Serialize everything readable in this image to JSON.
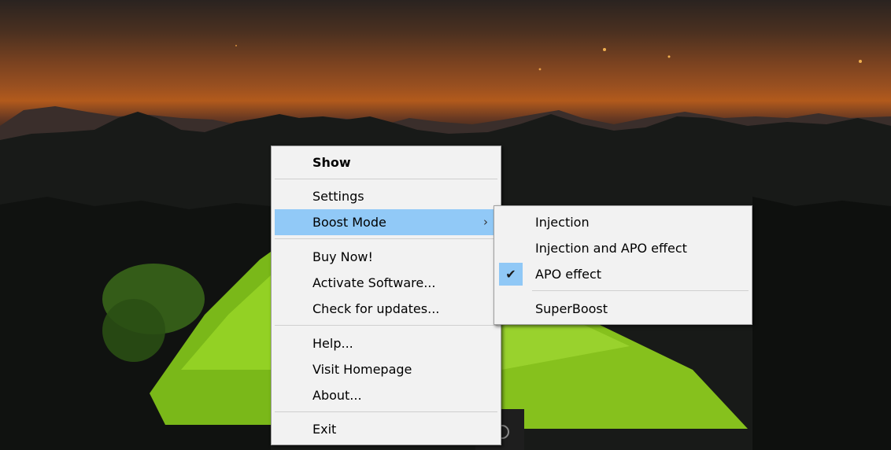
{
  "tray_menu": {
    "show": "Show",
    "settings": "Settings",
    "boost_mode": "Boost Mode",
    "buy_now": "Buy Now!",
    "activate": "Activate Software...",
    "check_updates": "Check for updates...",
    "help": "Help...",
    "visit_homepage": "Visit Homepage",
    "about": "About...",
    "exit": "Exit",
    "submenu_arrow": "›"
  },
  "boost_submenu": {
    "injection": "Injection",
    "injection_apo": "Injection and APO effect",
    "apo_effect": "APO effect",
    "superboost": "SuperBoost",
    "checked_item": "APO effect",
    "check_glyph": "✔"
  },
  "colors": {
    "menu_background": "#f2f2f2",
    "highlight": "#91c9f7",
    "border": "#a0a0a0"
  },
  "icons": {
    "submenu_arrow": "chevron-right-icon",
    "checked": "checkmark-icon",
    "taskbar": "tray-app-icon"
  }
}
